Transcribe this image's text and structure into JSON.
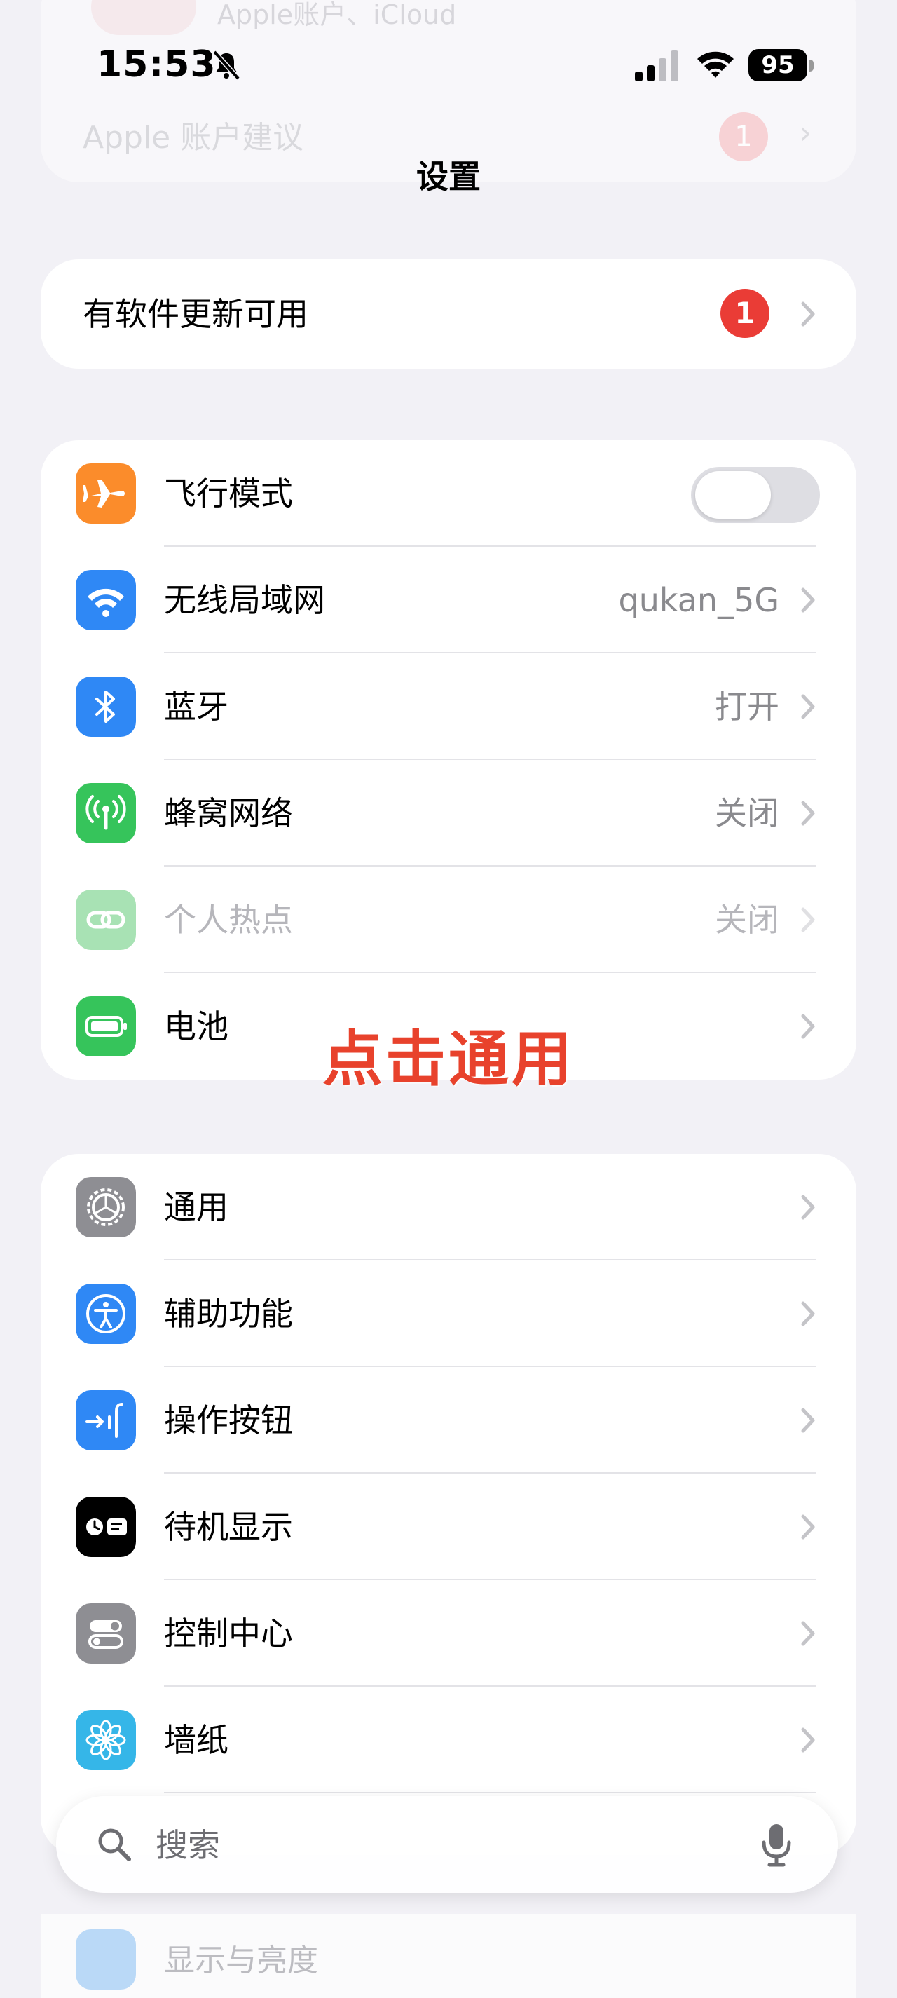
{
  "ghost": {
    "account_label": "Apple账户、iCloud",
    "suggestion_label": "Apple 账户建议",
    "suggestion_badge": "1"
  },
  "status_bar": {
    "time": "15:53",
    "battery_level": "95"
  },
  "nav": {
    "title": "设置"
  },
  "update_banner": {
    "label": "有软件更新可用",
    "badge": "1"
  },
  "connectivity": [
    {
      "id": "airplane",
      "label": "飞行模式",
      "value": "",
      "icon": "airplane-icon",
      "color": "#fb8c2b",
      "toggle": false,
      "disabled": false
    },
    {
      "id": "wifi",
      "label": "无线局域网",
      "value": "qukan_5G",
      "icon": "wifi-icon",
      "color": "#2f88f5",
      "disabled": false
    },
    {
      "id": "bluetooth",
      "label": "蓝牙",
      "value": "打开",
      "icon": "bluetooth-icon",
      "color": "#2f88f5",
      "disabled": false
    },
    {
      "id": "cellular",
      "label": "蜂窝网络",
      "value": "关闭",
      "icon": "cellular-antenna-icon",
      "color": "#36c45b",
      "disabled": false
    },
    {
      "id": "hotspot",
      "label": "个人热点",
      "value": "关闭",
      "icon": "hotspot-link-icon",
      "color": "#9fdcab",
      "disabled": true
    },
    {
      "id": "battery",
      "label": "电池",
      "value": "",
      "icon": "battery-icon",
      "color": "#36c45b",
      "disabled": false
    }
  ],
  "general_section": [
    {
      "id": "general",
      "label": "通用",
      "icon": "gear-icon",
      "color": "#8e8e93"
    },
    {
      "id": "accessibility",
      "label": "辅助功能",
      "icon": "accessibility-icon",
      "color": "#2f88f5"
    },
    {
      "id": "action_button",
      "label": "操作按钮",
      "icon": "action-button-icon",
      "color": "#2f88f5"
    },
    {
      "id": "standby",
      "label": "待机显示",
      "icon": "standby-icon",
      "color": "#000000"
    },
    {
      "id": "control_center",
      "label": "控制中心",
      "icon": "control-center-icon",
      "color": "#8e8e93"
    },
    {
      "id": "wallpaper",
      "label": "墙纸",
      "icon": "wallpaper-flower-icon",
      "color": "#35b6e8"
    }
  ],
  "overlay_caption": "点击通用",
  "search": {
    "placeholder": "搜索"
  },
  "peek_row": {
    "label": "显示与亮度"
  }
}
